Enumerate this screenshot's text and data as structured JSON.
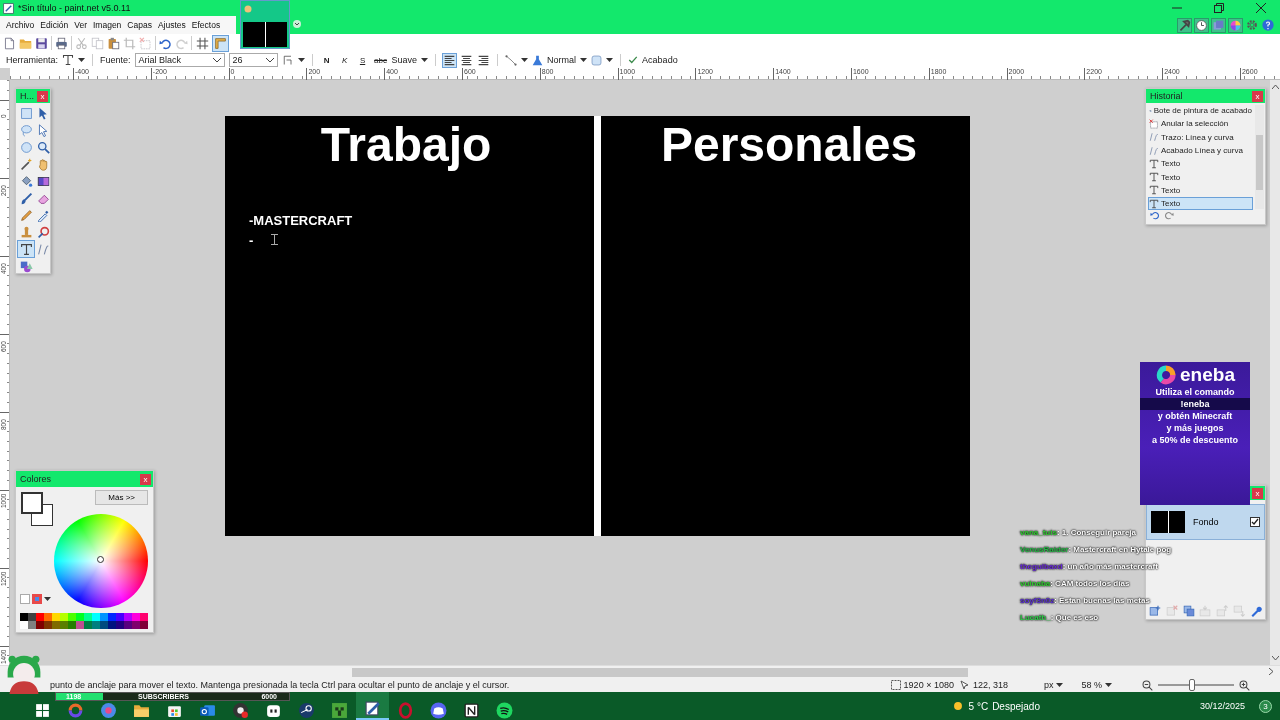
{
  "window": {
    "title": "*Sin título - paint.net v5.0.11"
  },
  "menu": [
    "Archivo",
    "Edición",
    "Ver",
    "Imagen",
    "Capas",
    "Ajustes",
    "Efectos"
  ],
  "image_tabs": [
    {
      "selected": true
    }
  ],
  "toolbar": {
    "buttons": [
      {
        "kind": "new",
        "disabled": false
      },
      {
        "kind": "open",
        "disabled": false
      },
      {
        "kind": "save",
        "disabled": false
      },
      {
        "kind": "print",
        "disabled": false
      },
      {
        "kind": "cut",
        "disabled": true
      },
      {
        "kind": "copy",
        "disabled": true
      },
      {
        "kind": "paste",
        "disabled": false
      },
      {
        "kind": "crop",
        "disabled": true
      },
      {
        "kind": "deselect",
        "disabled": true
      },
      {
        "kind": "undo",
        "disabled": false
      },
      {
        "kind": "redo",
        "disabled": true
      }
    ],
    "toggles": [
      {
        "kind": "grid",
        "on": false
      },
      {
        "kind": "rulers",
        "on": true
      }
    ]
  },
  "tool_options": {
    "tool_label": "Herramienta:",
    "font_label": "Fuente:",
    "font": "Arial Black",
    "size": "26",
    "styles": [
      {
        "label": "N",
        "kind": "bold",
        "on": false
      },
      {
        "label": "K",
        "kind": "italic",
        "on": false
      },
      {
        "label": "S",
        "kind": "underline",
        "on": false
      },
      {
        "label": "abc",
        "kind": "strike",
        "on": false
      }
    ],
    "antialias": "Suave",
    "alignment": [
      {
        "kind": "left",
        "selected": true
      },
      {
        "kind": "center",
        "selected": false
      },
      {
        "kind": "right",
        "selected": false
      }
    ],
    "blend_mode": "Normal",
    "finish": "Acabado"
  },
  "rulers": {
    "horizontal": [
      "-400",
      "-200",
      "0",
      "200",
      "400",
      "600",
      "800",
      "1000",
      "1200",
      "1400",
      "1600",
      "1800",
      "2000",
      "2200",
      "2400",
      "2600"
    ],
    "vertical": [
      "0",
      "200",
      "400",
      "600",
      "800",
      "1000",
      "1200",
      "1400"
    ]
  },
  "canvas": {
    "columns": [
      {
        "heading": "Trabajo",
        "lines": [
          "-MASTERCRAFT",
          "-"
        ]
      },
      {
        "heading": "Personales"
      }
    ]
  },
  "tools_panel": {
    "title": "H...",
    "close": "x",
    "tools": [
      {
        "kind": "rect-select",
        "selected": false
      },
      {
        "kind": "move-selection",
        "selected": false
      },
      {
        "kind": "lasso",
        "selected": false
      },
      {
        "kind": "move-selected",
        "selected": false
      },
      {
        "kind": "ellipse-select",
        "selected": false
      },
      {
        "kind": "zoom",
        "selected": false
      },
      {
        "kind": "magic-wand",
        "selected": false
      },
      {
        "kind": "pan",
        "selected": false
      },
      {
        "kind": "paint-bucket",
        "selected": false
      },
      {
        "kind": "gradient",
        "selected": false
      },
      {
        "kind": "paintbrush",
        "selected": false
      },
      {
        "kind": "eraser",
        "selected": false
      },
      {
        "kind": "pencil",
        "selected": false
      },
      {
        "kind": "color-picker",
        "selected": false
      },
      {
        "kind": "clone-stamp",
        "selected": false
      },
      {
        "kind": "recolor",
        "selected": false
      },
      {
        "kind": "text",
        "selected": true
      },
      {
        "kind": "line-curve",
        "selected": false
      },
      {
        "kind": "shapes",
        "selected": false
      }
    ]
  },
  "colors_panel": {
    "title": "Colores",
    "close": "x",
    "more": "Más >>",
    "palette": [
      {
        "color": "#000000"
      },
      {
        "color": "#404040"
      },
      {
        "color": "#ff0000"
      },
      {
        "color": "#ff6a00"
      },
      {
        "color": "#ffd800"
      },
      {
        "color": "#b6ff00"
      },
      {
        "color": "#4cff00"
      },
      {
        "color": "#00ff21"
      },
      {
        "color": "#00ff90"
      },
      {
        "color": "#00ffff"
      },
      {
        "color": "#0094ff"
      },
      {
        "color": "#0026ff"
      },
      {
        "color": "#4800ff"
      },
      {
        "color": "#b200ff"
      },
      {
        "color": "#ff00dc"
      },
      {
        "color": "#ff006e"
      },
      {
        "color": "#ffffff"
      },
      {
        "color": "#808080"
      },
      {
        "color": "#7f0000"
      },
      {
        "color": "#7f3300"
      },
      {
        "color": "#7f6a00"
      },
      {
        "color": "#5b7f00"
      },
      {
        "color": "#267f00"
      },
      {
        "color": "#c05090"
      },
      {
        "color": "#007f46"
      },
      {
        "color": "#007f7f"
      },
      {
        "color": "#004a7f"
      },
      {
        "color": "#00137f"
      },
      {
        "color": "#21007f"
      },
      {
        "color": "#57007f"
      },
      {
        "color": "#7f006e"
      },
      {
        "color": "#7f0037"
      }
    ]
  },
  "history_panel": {
    "title": "Historial",
    "close": "x",
    "items": [
      {
        "kind": "bucket",
        "label": "Bote de pintura de acabado",
        "selected": false
      },
      {
        "kind": "deselect",
        "label": "Anular la selección",
        "selected": false
      },
      {
        "kind": "line",
        "label": "Trazo: Línea y curva",
        "selected": false
      },
      {
        "kind": "line",
        "label": "Acabado Línea y curva",
        "selected": false
      },
      {
        "kind": "text",
        "label": "Texto",
        "selected": false
      },
      {
        "kind": "text",
        "label": "Texto",
        "selected": false
      },
      {
        "kind": "text",
        "label": "Texto",
        "selected": false
      },
      {
        "kind": "text",
        "label": "Texto",
        "selected": true
      }
    ]
  },
  "layers_panel": {
    "close": "x",
    "layers": [
      {
        "name": "Fondo",
        "visible": true,
        "selected": true
      }
    ],
    "toolbar": [
      {
        "kind": "add",
        "disabled": false
      },
      {
        "kind": "delete",
        "disabled": true
      },
      {
        "kind": "duplicate",
        "disabled": false
      },
      {
        "kind": "merge",
        "disabled": true
      },
      {
        "kind": "up",
        "disabled": true
      },
      {
        "kind": "down",
        "disabled": true
      },
      {
        "kind": "properties",
        "disabled": false
      }
    ]
  },
  "status_bar": {
    "hint": "punto de anclaje para mover el texto. Mantenga presionada la tecla Ctrl para ocultar el punto de anclaje y el cursor.",
    "image_size": "1920 × 1080",
    "cursor": "122, 318",
    "units": "px",
    "zoom": "58 %",
    "zoom_slider": {
      "level": 0.45
    }
  },
  "taskbar": {
    "apps": [
      {
        "kind": "windows",
        "selected": false
      },
      {
        "kind": "swirl",
        "selected": false
      },
      {
        "kind": "browser",
        "selected": false
      },
      {
        "kind": "explorer",
        "selected": false
      },
      {
        "kind": "store",
        "selected": false
      },
      {
        "kind": "mail",
        "selected": false
      },
      {
        "kind": "record",
        "selected": false
      },
      {
        "kind": "robot",
        "selected": false
      },
      {
        "kind": "disc",
        "selected": false
      },
      {
        "kind": "block",
        "selected": false
      },
      {
        "kind": "paint",
        "selected": true
      },
      {
        "kind": "ring",
        "selected": false
      },
      {
        "kind": "gamepad",
        "selected": false
      },
      {
        "kind": "cube",
        "selected": false
      },
      {
        "kind": "waves",
        "selected": false
      }
    ],
    "temperature": "5 °C",
    "weather": "Despejado",
    "date": "30/12/2025",
    "notifications": "3"
  },
  "stream_overlay": {
    "subscribers": {
      "current": "1198",
      "label": "SUBSCRIBERS",
      "goal": "6000",
      "level": 0.2
    },
    "ad": {
      "brand": "eneba",
      "lines": [
        "Utiliza el comando",
        "!eneba",
        "y obtén Minecraft",
        "y más juegos",
        "a 50% de descuento"
      ]
    },
    "chat": [
      {
        "user": "vana_tuis",
        "color": "#33cc33",
        "message": ": 1. Conseguir pareja"
      },
      {
        "user": "VenusRaider",
        "color": "#22bb44",
        "message": ": Mastercraft en Hytale pog"
      },
      {
        "user": "thegulbaxd",
        "color": "#6a2bd8",
        "message": ": un año más mastercraft"
      },
      {
        "user": "vulnaba",
        "color": "#33cc33",
        "message": ": CAM todos los días"
      },
      {
        "user": "soyf3n0z",
        "color": "#5b2fd6",
        "message": ": Estan buenas las metas"
      },
      {
        "user": "Lucath_",
        "color": "#2fd04a",
        "message": ": Que es eso"
      }
    ]
  }
}
